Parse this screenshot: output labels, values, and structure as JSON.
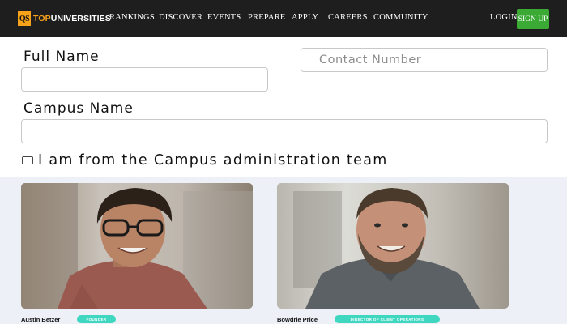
{
  "nav": {
    "logo_mark": "QS",
    "logo_text_a": "TOP",
    "logo_text_b": "UNIVERSITIES",
    "links": [
      "RANKINGS",
      "DISCOVER",
      "EVENTS",
      "PREPARE",
      "APPLY",
      "CAREERS",
      "COMMUNITY"
    ],
    "login": "LOGIN",
    "signup": "SIGN UP"
  },
  "form": {
    "full_name_label": "Full Name",
    "full_name_value": "",
    "contact_placeholder": "Contact Number",
    "campus_label": "Campus Name",
    "campus_value": "",
    "admin_checkbox_label": "I am from the Campus administration team",
    "admin_checked": false
  },
  "team": [
    {
      "name": "Austin Betzer",
      "role": "FOUNDER"
    },
    {
      "name": "Bowdrie Price",
      "role": "DIRECTOR OF CLIENT OPERATIONS"
    }
  ],
  "colors": {
    "nav_bg": "#1e1e1e",
    "logo_accent": "#f6a21a",
    "signup_green": "#3aaa35",
    "role_badge": "#3fd7c0",
    "team_section_bg": "#eef0f7"
  }
}
